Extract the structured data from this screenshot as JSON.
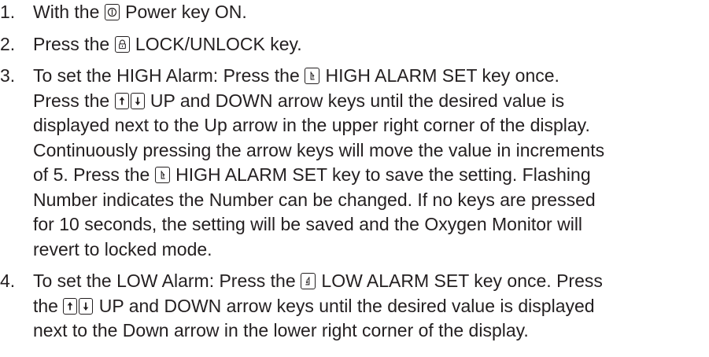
{
  "steps": [
    {
      "number": "1.",
      "parts": {
        "a": "With the",
        "icon": "power-key-icon",
        "b": " Power key ON."
      }
    },
    {
      "number": "2.",
      "parts": {
        "a": "Press the",
        "icon": "lock-key-icon",
        "b": " LOCK/UNLOCK key."
      }
    },
    {
      "number": "3.",
      "parts": {
        "a": "To set the HIGH Alarm: Press the",
        "icon1": "high-alarm-set-key-icon",
        "b": " HIGH ALARM SET key once.",
        "c": "Press the",
        "icon2": "up-down-arrow-keys-icon",
        "d": " UP and DOWN arrow keys until the desired value is",
        "e": "displayed next to the Up arrow in the upper right corner of the display.",
        "f": "Continuously pressing the arrow keys will move the value in increments",
        "g": "of 5. Press the",
        "icon3": "high-alarm-set-key-icon",
        "h": " HIGH ALARM SET key to save the setting. Flashing",
        "i": "Number indicates the Number can be changed. If no keys are pressed",
        "j": "for 10 seconds, the setting will be saved and the Oxygen Monitor will",
        "k": "revert to locked mode."
      }
    },
    {
      "number": "4.",
      "parts": {
        "a": "To set the LOW Alarm: Press the",
        "icon1": "low-alarm-set-key-icon",
        "b": " LOW ALARM SET key once. Press",
        "c": "the",
        "icon2": "up-down-arrow-keys-icon",
        "d": " UP and DOWN arrow keys until the desired value is displayed",
        "e": "next to the Down arrow in the lower right corner of the display."
      }
    }
  ]
}
